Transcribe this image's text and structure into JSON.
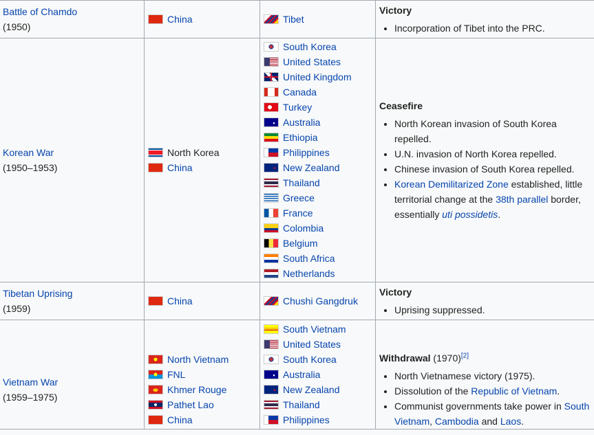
{
  "rows": [
    {
      "conflict": "Battle of Chamdo",
      "years": "(1950)",
      "side1": [
        {
          "name": "China",
          "flag": "flag-china"
        }
      ],
      "side2": [
        {
          "name": "Tibet",
          "flag": "flag-tibet"
        }
      ],
      "result_title": "Victory",
      "result_items": [
        "Incorporation of Tibet into the PRC."
      ]
    },
    {
      "conflict": "Korean War",
      "years": "(1950–1953)",
      "side1": [
        {
          "name": "North Korea",
          "flag": "flag-north-korea"
        },
        {
          "name": "China",
          "flag": "flag-china"
        }
      ],
      "side2": [
        {
          "name": "South Korea",
          "flag": "flag-south-korea"
        },
        {
          "name": "United States",
          "flag": "flag-usa"
        },
        {
          "name": "United Kingdom",
          "flag": "flag-uk"
        },
        {
          "name": "Canada",
          "flag": "flag-canada"
        },
        {
          "name": "Turkey",
          "flag": "flag-turkey"
        },
        {
          "name": "Australia",
          "flag": "flag-australia"
        },
        {
          "name": "Ethiopia",
          "flag": "flag-ethiopia"
        },
        {
          "name": "Philippines",
          "flag": "flag-philippines"
        },
        {
          "name": "New Zealand",
          "flag": "flag-new-zealand"
        },
        {
          "name": "Thailand",
          "flag": "flag-thailand"
        },
        {
          "name": "Greece",
          "flag": "flag-greece"
        },
        {
          "name": "France",
          "flag": "flag-france"
        },
        {
          "name": "Colombia",
          "flag": "flag-colombia"
        },
        {
          "name": "Belgium",
          "flag": "flag-belgium"
        },
        {
          "name": "South Africa",
          "flag": "flag-south-africa"
        },
        {
          "name": "Netherlands",
          "flag": "flag-netherlands"
        }
      ],
      "result_title": "Ceasefire",
      "result_items": [
        "North Korean invasion of South Korea repelled.",
        "U.N. invasion of North Korea repelled.",
        "Chinese invasion of South Korea repelled."
      ],
      "result_dmz": {
        "link1": "Korean Demilitarized Zone",
        "text1": " established, little territorial change at the ",
        "link2": "38th parallel",
        "text2": " border, essentially ",
        "link3": "uti possidetis",
        "text3": "."
      }
    },
    {
      "conflict": "Tibetan Uprising",
      "years": "(1959)",
      "side1": [
        {
          "name": "China",
          "flag": "flag-china"
        }
      ],
      "side2": [
        {
          "name": "Chushi Gangdruk",
          "flag": "flag-tibet"
        }
      ],
      "result_title": "Victory",
      "result_items": [
        "Uprising suppressed."
      ]
    },
    {
      "conflict": "Vietnam War",
      "years": "(1959–1975)",
      "side1": [
        {
          "name": "North Vietnam",
          "flag": "flag-north-vietnam"
        },
        {
          "name": "FNL",
          "flag": "flag-fnl"
        },
        {
          "name": "Khmer Rouge",
          "flag": "flag-khmer-rouge"
        },
        {
          "name": "Pathet Lao",
          "flag": "flag-laos"
        },
        {
          "name": "China",
          "flag": "flag-china"
        }
      ],
      "side2": [
        {
          "name": "South Vietnam",
          "flag": "flag-south-vietnam"
        },
        {
          "name": "United States",
          "flag": "flag-usa"
        },
        {
          "name": "South Korea",
          "flag": "flag-south-korea"
        },
        {
          "name": "Australia",
          "flag": "flag-australia"
        },
        {
          "name": "New Zealand",
          "flag": "flag-new-zealand"
        },
        {
          "name": "Thailand",
          "flag": "flag-thailand"
        },
        {
          "name": "Philippines",
          "flag": "flag-philippines"
        }
      ],
      "result_title": "Withdrawal",
      "result_title_suffix": " (1970)",
      "result_ref": "[2]",
      "result_items": [
        "North Vietnamese victory (1975)."
      ],
      "result_rov": {
        "text1": "Dissolution of the ",
        "link1": "Republic of Vietnam",
        "text2": "."
      },
      "result_comm": {
        "text1": "Communist governments take power in ",
        "link1": "South Vietnam",
        "text2": ", ",
        "link2": "Cambodia",
        "text3": " and ",
        "link3": "Laos",
        "text4": "."
      }
    }
  ],
  "colors": {
    "link": "#0645ad",
    "border": "#a2a9b1",
    "background": "#f8f9fa"
  }
}
